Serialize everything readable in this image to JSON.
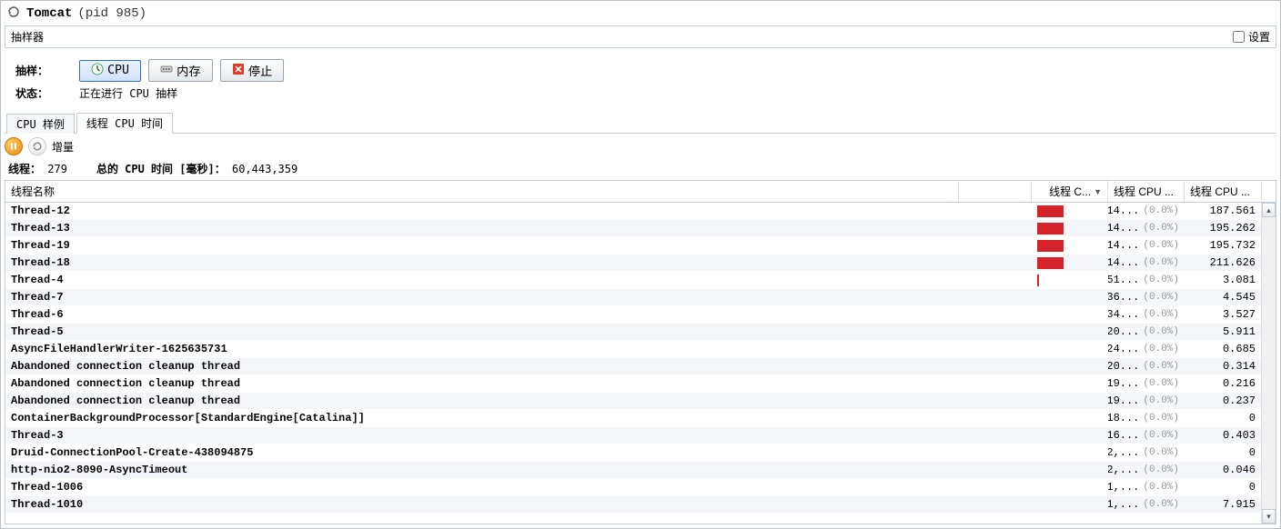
{
  "title": {
    "app": "Tomcat",
    "pid": "(pid 985)"
  },
  "section": {
    "title": "抽样器",
    "settings_label": "设置"
  },
  "controls": {
    "row1_label": "抽样：",
    "cpu_button": "CPU",
    "mem_button": "内存",
    "stop_button": "停止",
    "row2_label": "状态：",
    "status_text": "正在进行 CPU 抽样"
  },
  "subtabs": {
    "tab1": "CPU 样例",
    "tab2": "线程 CPU 时间"
  },
  "toolbar": {
    "delta_label": "增量"
  },
  "summary": {
    "threads_label": "线程：",
    "threads_value": "279",
    "total_label": "总的 CPU 时间 [毫秒]：",
    "total_value": "60,443,359"
  },
  "columns": {
    "name": "线程名称",
    "c1": "线程 C...",
    "c2": "线程 CPU ...",
    "c3": "线程 CPU ..."
  },
  "rows": [
    {
      "name": "Thread-12",
      "bar": 38,
      "v1": "14...",
      "pct": "(0.0%)",
      "v3": "187.561"
    },
    {
      "name": "Thread-13",
      "bar": 38,
      "v1": "14...",
      "pct": "(0.0%)",
      "v3": "195.262"
    },
    {
      "name": "Thread-19",
      "bar": 38,
      "v1": "14...",
      "pct": "(0.0%)",
      "v3": "195.732"
    },
    {
      "name": "Thread-18",
      "bar": 38,
      "v1": "14...",
      "pct": "(0.0%)",
      "v3": "211.626"
    },
    {
      "name": "Thread-4",
      "bar": 2,
      "v1": "51...",
      "pct": "(0.0%)",
      "v3": "3.081"
    },
    {
      "name": "Thread-7",
      "bar": 0,
      "v1": "36...",
      "pct": "(0.0%)",
      "v3": "4.545"
    },
    {
      "name": "Thread-6",
      "bar": 0,
      "v1": "34...",
      "pct": "(0.0%)",
      "v3": "3.527"
    },
    {
      "name": "Thread-5",
      "bar": 0,
      "v1": "20...",
      "pct": "(0.0%)",
      "v3": "5.911"
    },
    {
      "name": "AsyncFileHandlerWriter-1625635731",
      "bar": 0,
      "v1": "24...",
      "pct": "(0.0%)",
      "v3": "0.685"
    },
    {
      "name": "Abandoned connection cleanup thread",
      "bar": 0,
      "v1": "20...",
      "pct": "(0.0%)",
      "v3": "0.314"
    },
    {
      "name": "Abandoned connection cleanup thread",
      "bar": 0,
      "v1": "19...",
      "pct": "(0.0%)",
      "v3": "0.216"
    },
    {
      "name": "Abandoned connection cleanup thread",
      "bar": 0,
      "v1": "19...",
      "pct": "(0.0%)",
      "v3": "0.237"
    },
    {
      "name": "ContainerBackgroundProcessor[StandardEngine[Catalina]]",
      "bar": 0,
      "v1": "18...",
      "pct": "(0.0%)",
      "v3": "0"
    },
    {
      "name": "Thread-3",
      "bar": 0,
      "v1": "16...",
      "pct": "(0.0%)",
      "v3": "0.403"
    },
    {
      "name": "Druid-ConnectionPool-Create-438094875",
      "bar": 0,
      "v1": "2,...",
      "pct": "(0.0%)",
      "v3": "0"
    },
    {
      "name": "http-nio2-8090-AsyncTimeout",
      "bar": 0,
      "v1": "2,...",
      "pct": "(0.0%)",
      "v3": "0.046"
    },
    {
      "name": "Thread-1006",
      "bar": 0,
      "v1": "1,...",
      "pct": "(0.0%)",
      "v3": "0"
    },
    {
      "name": "Thread-1010",
      "bar": 0,
      "v1": "1,...",
      "pct": "(0.0%)",
      "v3": "7.915"
    }
  ]
}
